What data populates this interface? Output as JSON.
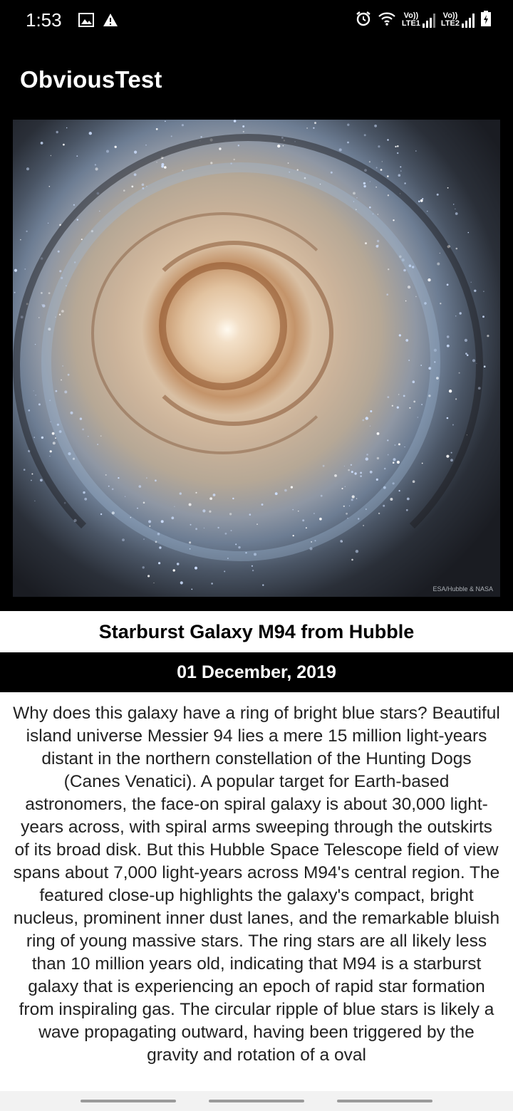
{
  "status_bar": {
    "time": "1:53",
    "left_icons": [
      "image-icon",
      "warning-icon"
    ],
    "right_icons": [
      "alarm-icon",
      "wifi-icon",
      "signal-icon",
      "signal-icon",
      "battery-icon"
    ],
    "sim1_label_top": "Vo))",
    "sim1_label_bottom": "LTE1",
    "sim2_label_top": "Vo))",
    "sim2_label_bottom": "LTE2"
  },
  "app_bar": {
    "title": "ObviousTest"
  },
  "image": {
    "credit": "ESA/Hubble & NASA"
  },
  "apod": {
    "title": "Starburst Galaxy M94 from Hubble",
    "date": "01 December, 2019",
    "explanation": "Why does this galaxy have a ring of bright blue stars? Beautiful island universe Messier 94 lies a mere 15 million light-years distant in the northern constellation of the Hunting Dogs (Canes Venatici). A popular target for Earth-based astronomers, the face-on spiral galaxy is about 30,000 light-years across, with spiral arms sweeping through the outskirts of its broad disk. But this Hubble Space Telescope field of view spans about 7,000 light-years across M94's central region. The featured close-up highlights the galaxy's compact, bright nucleus, prominent inner dust lanes, and the remarkable bluish ring of young massive stars. The ring stars are all likely less than 10 million years old, indicating that M94 is a starburst galaxy that is experiencing an epoch of rapid star formation from inspiraling gas. The circular ripple of blue stars is likely a wave propagating outward, having been triggered by the gravity and rotation of a oval"
  }
}
